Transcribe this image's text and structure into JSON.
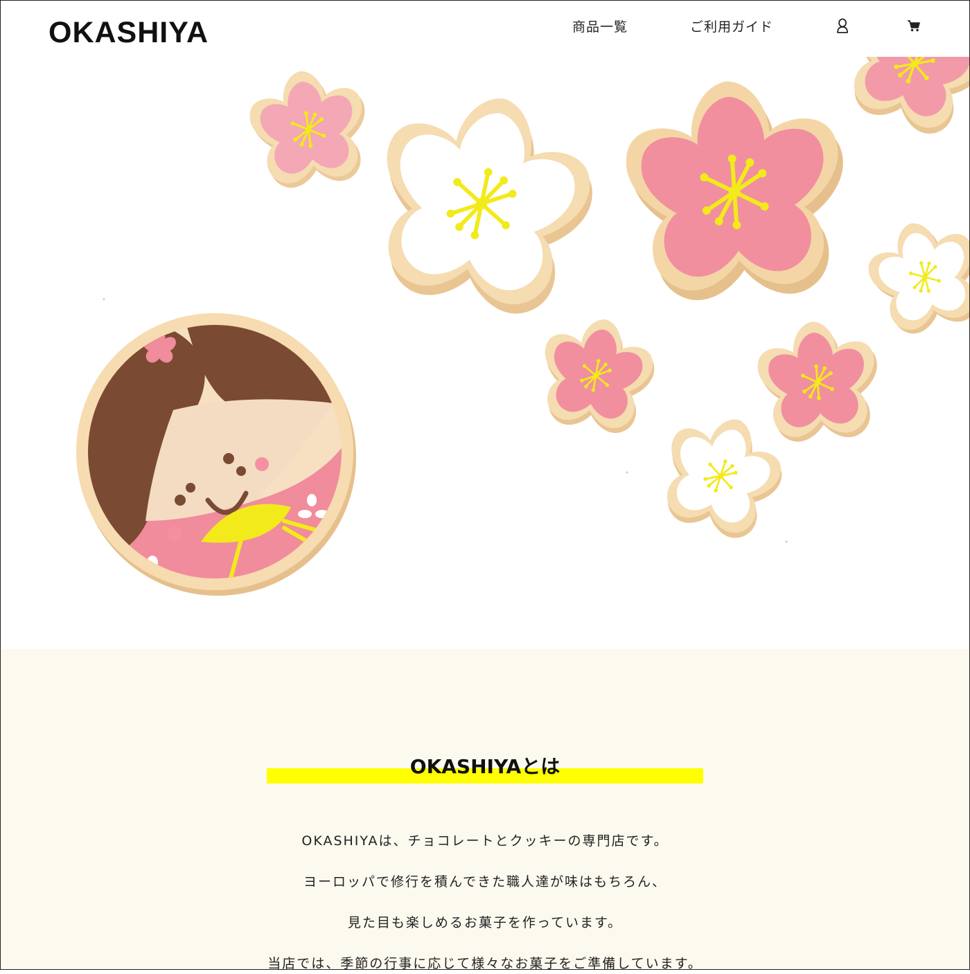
{
  "header": {
    "logo": "OKASHIYA",
    "nav": {
      "products": "商品一覧",
      "guide": "ご利用ガイド"
    },
    "icons": {
      "account": "user-icon",
      "cart": "cart-icon"
    }
  },
  "hero": {
    "image": "decorated-icing-cookies-photo"
  },
  "about": {
    "title": "OKASHIYAとは",
    "paragraphs": [
      "OKASHIYAは、チョコレートとクッキーの専門店です。",
      "ヨーロッパで修行を積んできた職人達が味はもちろん、",
      "見た目も楽しめるお菓子を作っています。",
      "当店では、季節の行事に応じて様々なお菓子をご準備しています。"
    ]
  },
  "colors": {
    "about_bg": "#fcf9ef",
    "highlight": "#ffff00",
    "cookie_pink": "#f08e9e",
    "icing_white": "#ffffff",
    "dough": "#f3d7a6",
    "stamen_yellow": "#f2ea1a"
  }
}
